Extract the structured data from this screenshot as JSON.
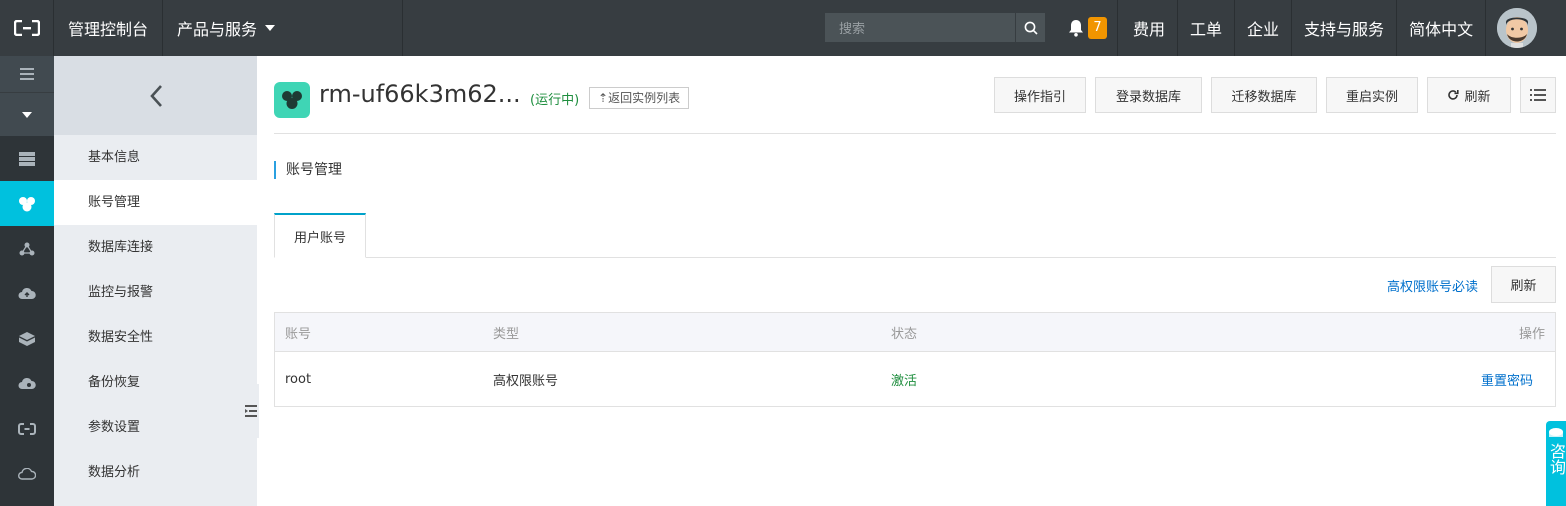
{
  "topbar": {
    "console": "管理控制台",
    "products": "产品与服务",
    "search_placeholder": "搜索",
    "notification_count": "7",
    "right_items": [
      "费用",
      "工单",
      "企业",
      "支持与服务",
      "简体中文"
    ]
  },
  "subnav": {
    "items": [
      "基本信息",
      "账号管理",
      "数据库连接",
      "监控与报警",
      "数据安全性",
      "备份恢复",
      "参数设置",
      "数据分析"
    ],
    "active_index": 1
  },
  "header": {
    "instance_name": "rm-uf66k3m62...",
    "status": "(运行中)",
    "back_label": "返回实例列表",
    "buttons": [
      "操作指引",
      "登录数据库",
      "迁移数据库",
      "重启实例",
      "刷新"
    ]
  },
  "section": {
    "title": "账号管理"
  },
  "tabs": [
    {
      "label": "用户账号"
    }
  ],
  "toolbar": {
    "read_link": "高权限账号必读",
    "refresh": "刷新"
  },
  "table": {
    "columns": [
      "账号",
      "类型",
      "状态",
      "操作"
    ],
    "rows": [
      {
        "account": "root",
        "type": "高权限账号",
        "status": "激活",
        "action": "重置密码"
      }
    ]
  },
  "consult": {
    "label": "咨询"
  },
  "colors": {
    "accent": "#00c1de",
    "topbar": "#373d41",
    "running": "#1e8e3e",
    "link": "#0070cc",
    "badge": "#f19500"
  }
}
